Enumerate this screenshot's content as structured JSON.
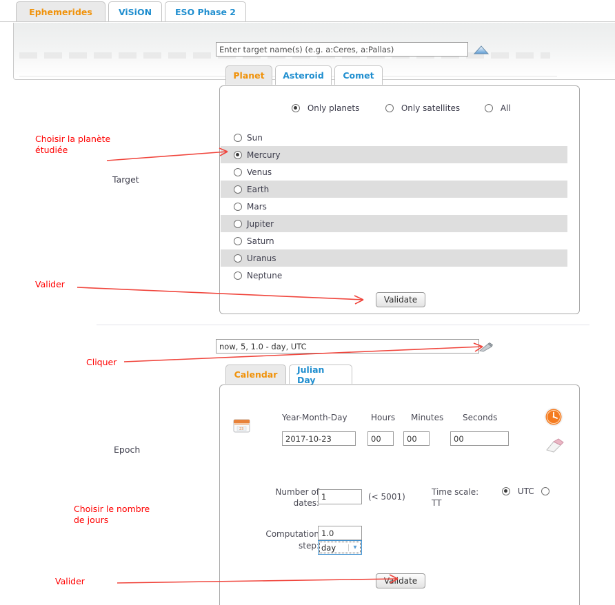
{
  "top_tabs": [
    {
      "label": "Ephemerides",
      "selected": true
    },
    {
      "label": "ViSiON",
      "selected": false
    },
    {
      "label": "ESO Phase 2",
      "selected": false
    }
  ],
  "target_section": {
    "side_label": "Target",
    "input_placeholder": "Enter target name(s) (e.g. a:Ceres, a:Pallas)",
    "input_value": "",
    "collapse_icon": "triangle-up-icon",
    "tabs": [
      {
        "label": "Planet",
        "selected": true
      },
      {
        "label": "Asteroid",
        "selected": false
      },
      {
        "label": "Comet",
        "selected": false
      }
    ],
    "filter_options": [
      {
        "label": "Only planets",
        "selected": true
      },
      {
        "label": "Only satellites",
        "selected": false
      },
      {
        "label": "All",
        "selected": false
      }
    ],
    "bodies": [
      {
        "label": "Sun",
        "selected": false
      },
      {
        "label": "Mercury",
        "selected": true
      },
      {
        "label": "Venus",
        "selected": false
      },
      {
        "label": "Earth",
        "selected": false
      },
      {
        "label": "Mars",
        "selected": false
      },
      {
        "label": "Jupiter",
        "selected": false
      },
      {
        "label": "Saturn",
        "selected": false
      },
      {
        "label": "Uranus",
        "selected": false
      },
      {
        "label": "Neptune",
        "selected": false
      }
    ],
    "validate_label": "Validate"
  },
  "epoch_section": {
    "side_label": "Epoch",
    "summary_value": "now, 5, 1.0 - day, UTC",
    "edit_icon": "pencil-icon",
    "tabs": [
      {
        "label": "Calendar",
        "selected": true
      },
      {
        "label": "Julian Day",
        "selected": false
      }
    ],
    "calendar_icon": "calendar-icon",
    "clock_icon": "clock-icon",
    "eraser_icon": "eraser-icon",
    "field_headers": {
      "date": "Year-Month-Day",
      "hours": "Hours",
      "minutes": "Minutes",
      "seconds": "Seconds"
    },
    "field_values": {
      "date": "2017-10-23",
      "hours": "00",
      "minutes": "00",
      "seconds": "00"
    },
    "number_of_dates": {
      "label_line1": "Number of",
      "label_line2": "dates:",
      "value": "1",
      "hint": "(< 5001)"
    },
    "time_scale": {
      "label": "Time scale:",
      "options": [
        {
          "label": "UTC",
          "selected": true
        },
        {
          "label": "TT",
          "selected": false
        }
      ]
    },
    "computation_step": {
      "label_line1": "Computation",
      "label_line2": "step:",
      "value": "1.0",
      "unit": "day"
    },
    "validate_label": "Validate"
  },
  "annotations": [
    {
      "id": "a1",
      "line1": "Choisir la planète",
      "line2": "étudiée"
    },
    {
      "id": "a2",
      "line1": "Valider",
      "line2": ""
    },
    {
      "id": "a3",
      "line1": "Cliquer",
      "line2": ""
    },
    {
      "id": "a4",
      "line1": "Choisir le nombre",
      "line2": "de jours"
    },
    {
      "id": "a5",
      "line1": "Valider",
      "line2": ""
    }
  ],
  "colors": {
    "accent_orange": "#f0920a",
    "link_blue": "#1f8ecf",
    "annotation_red": "#ff0000",
    "row_alt": "#dedede",
    "panel_border": "#a9a9a9"
  }
}
